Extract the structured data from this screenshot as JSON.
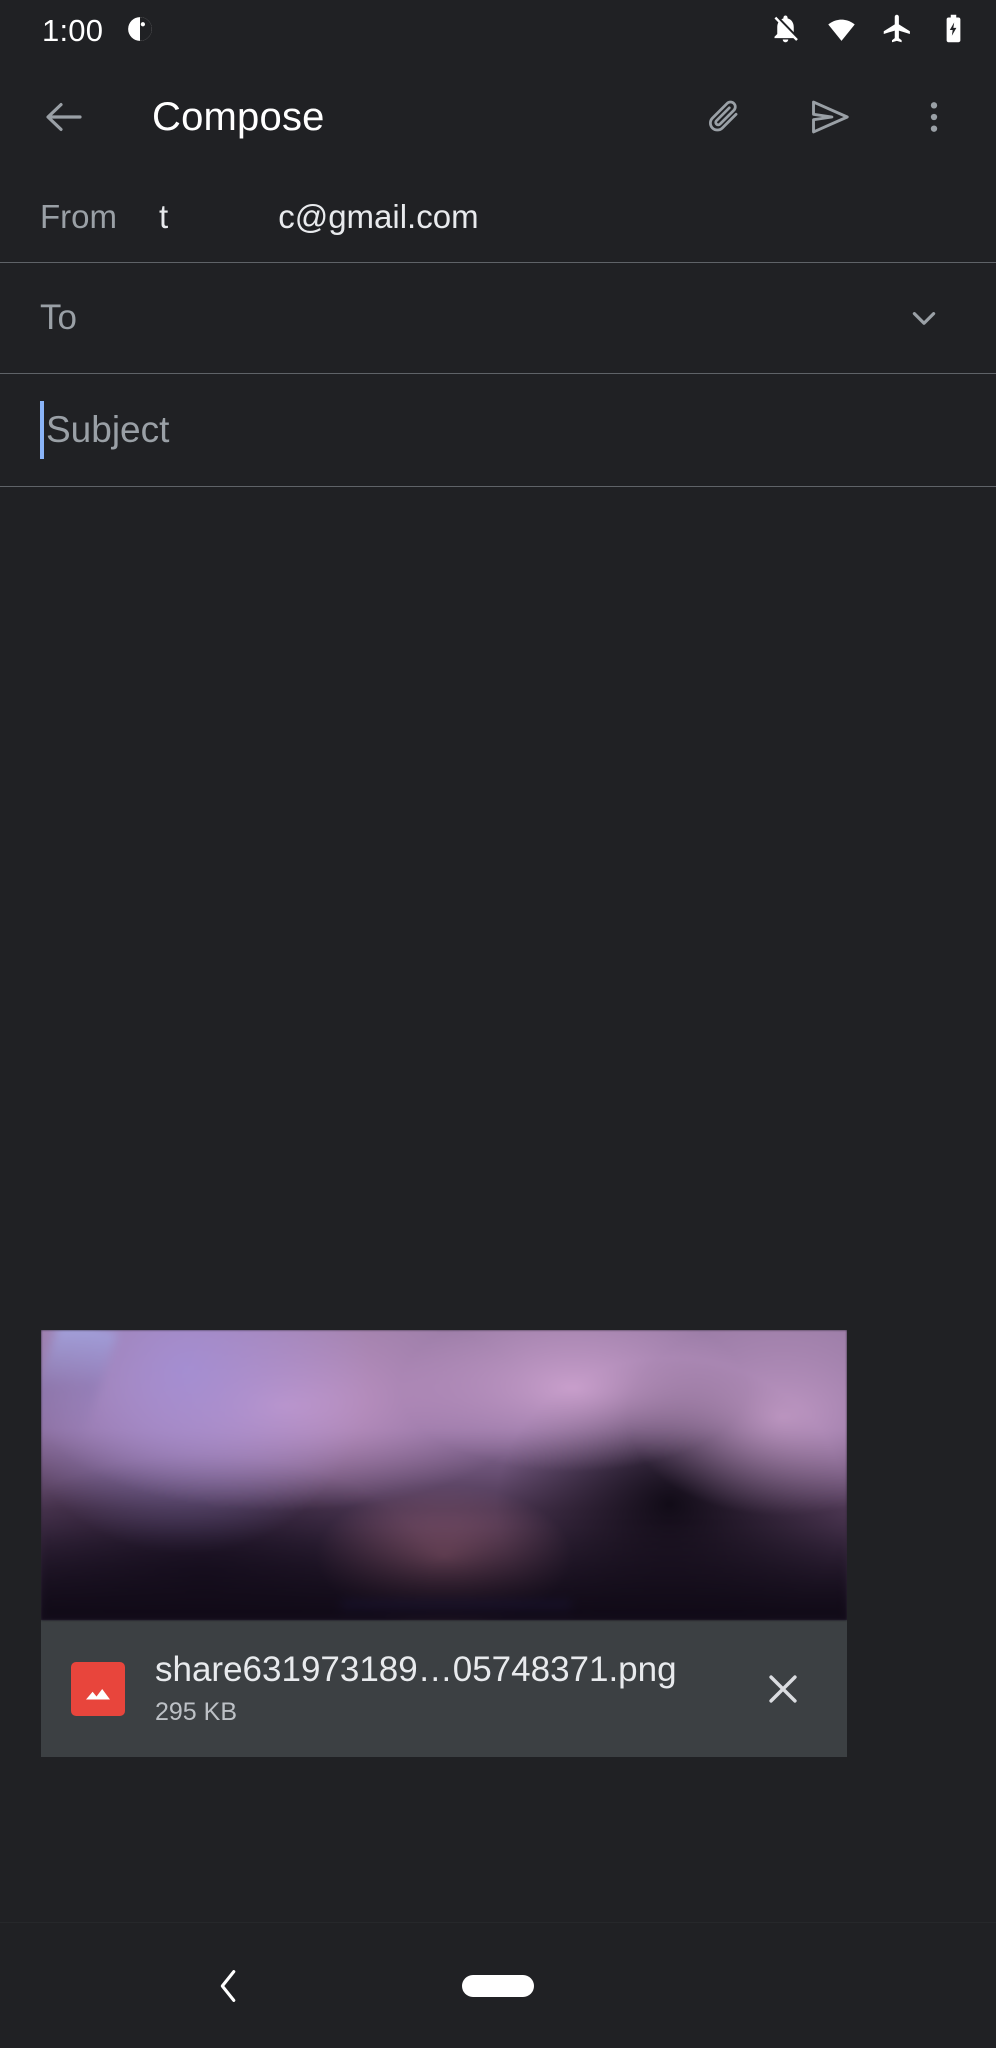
{
  "app": {
    "theme_background": "#202124",
    "accent_caret": "#8ab4f8",
    "divider_color": "#5f6368"
  },
  "status_bar": {
    "time": "1:00",
    "left_icons": [
      {
        "name": "notification-dot-icon",
        "label": "notification"
      }
    ],
    "right_icons": [
      {
        "name": "notifications-off-icon",
        "label": "Notifications silenced"
      },
      {
        "name": "wifi-icon",
        "label": "Wi-Fi connected"
      },
      {
        "name": "airplane-mode-icon",
        "label": "Airplane mode on"
      },
      {
        "name": "battery-charging-icon",
        "label": "Battery charging"
      }
    ]
  },
  "app_bar": {
    "title": "Compose",
    "back_label": "Navigate up",
    "actions": [
      {
        "name": "attach-file-button",
        "label": "Attach file"
      },
      {
        "name": "send-button",
        "label": "Send"
      },
      {
        "name": "more-options-button",
        "label": "More options"
      }
    ]
  },
  "compose": {
    "from": {
      "label": "From",
      "value": "t            c@gmail.com"
    },
    "to": {
      "placeholder": "To",
      "value": "",
      "expand_label": "Show Cc/Bcc"
    },
    "subject": {
      "placeholder": "Subject",
      "value": "",
      "caret_visible": true
    },
    "body": {
      "placeholder": "",
      "value": ""
    }
  },
  "attachment": {
    "file_name": "share631973189…05748371.png",
    "file_size": "295 KB",
    "file_type_icon": "image-file-icon",
    "remove_label": "Remove attachment",
    "thumbnail_alt": "Blurred purple image preview"
  },
  "nav_bar": {
    "back_label": "Back",
    "home_label": "Home"
  }
}
